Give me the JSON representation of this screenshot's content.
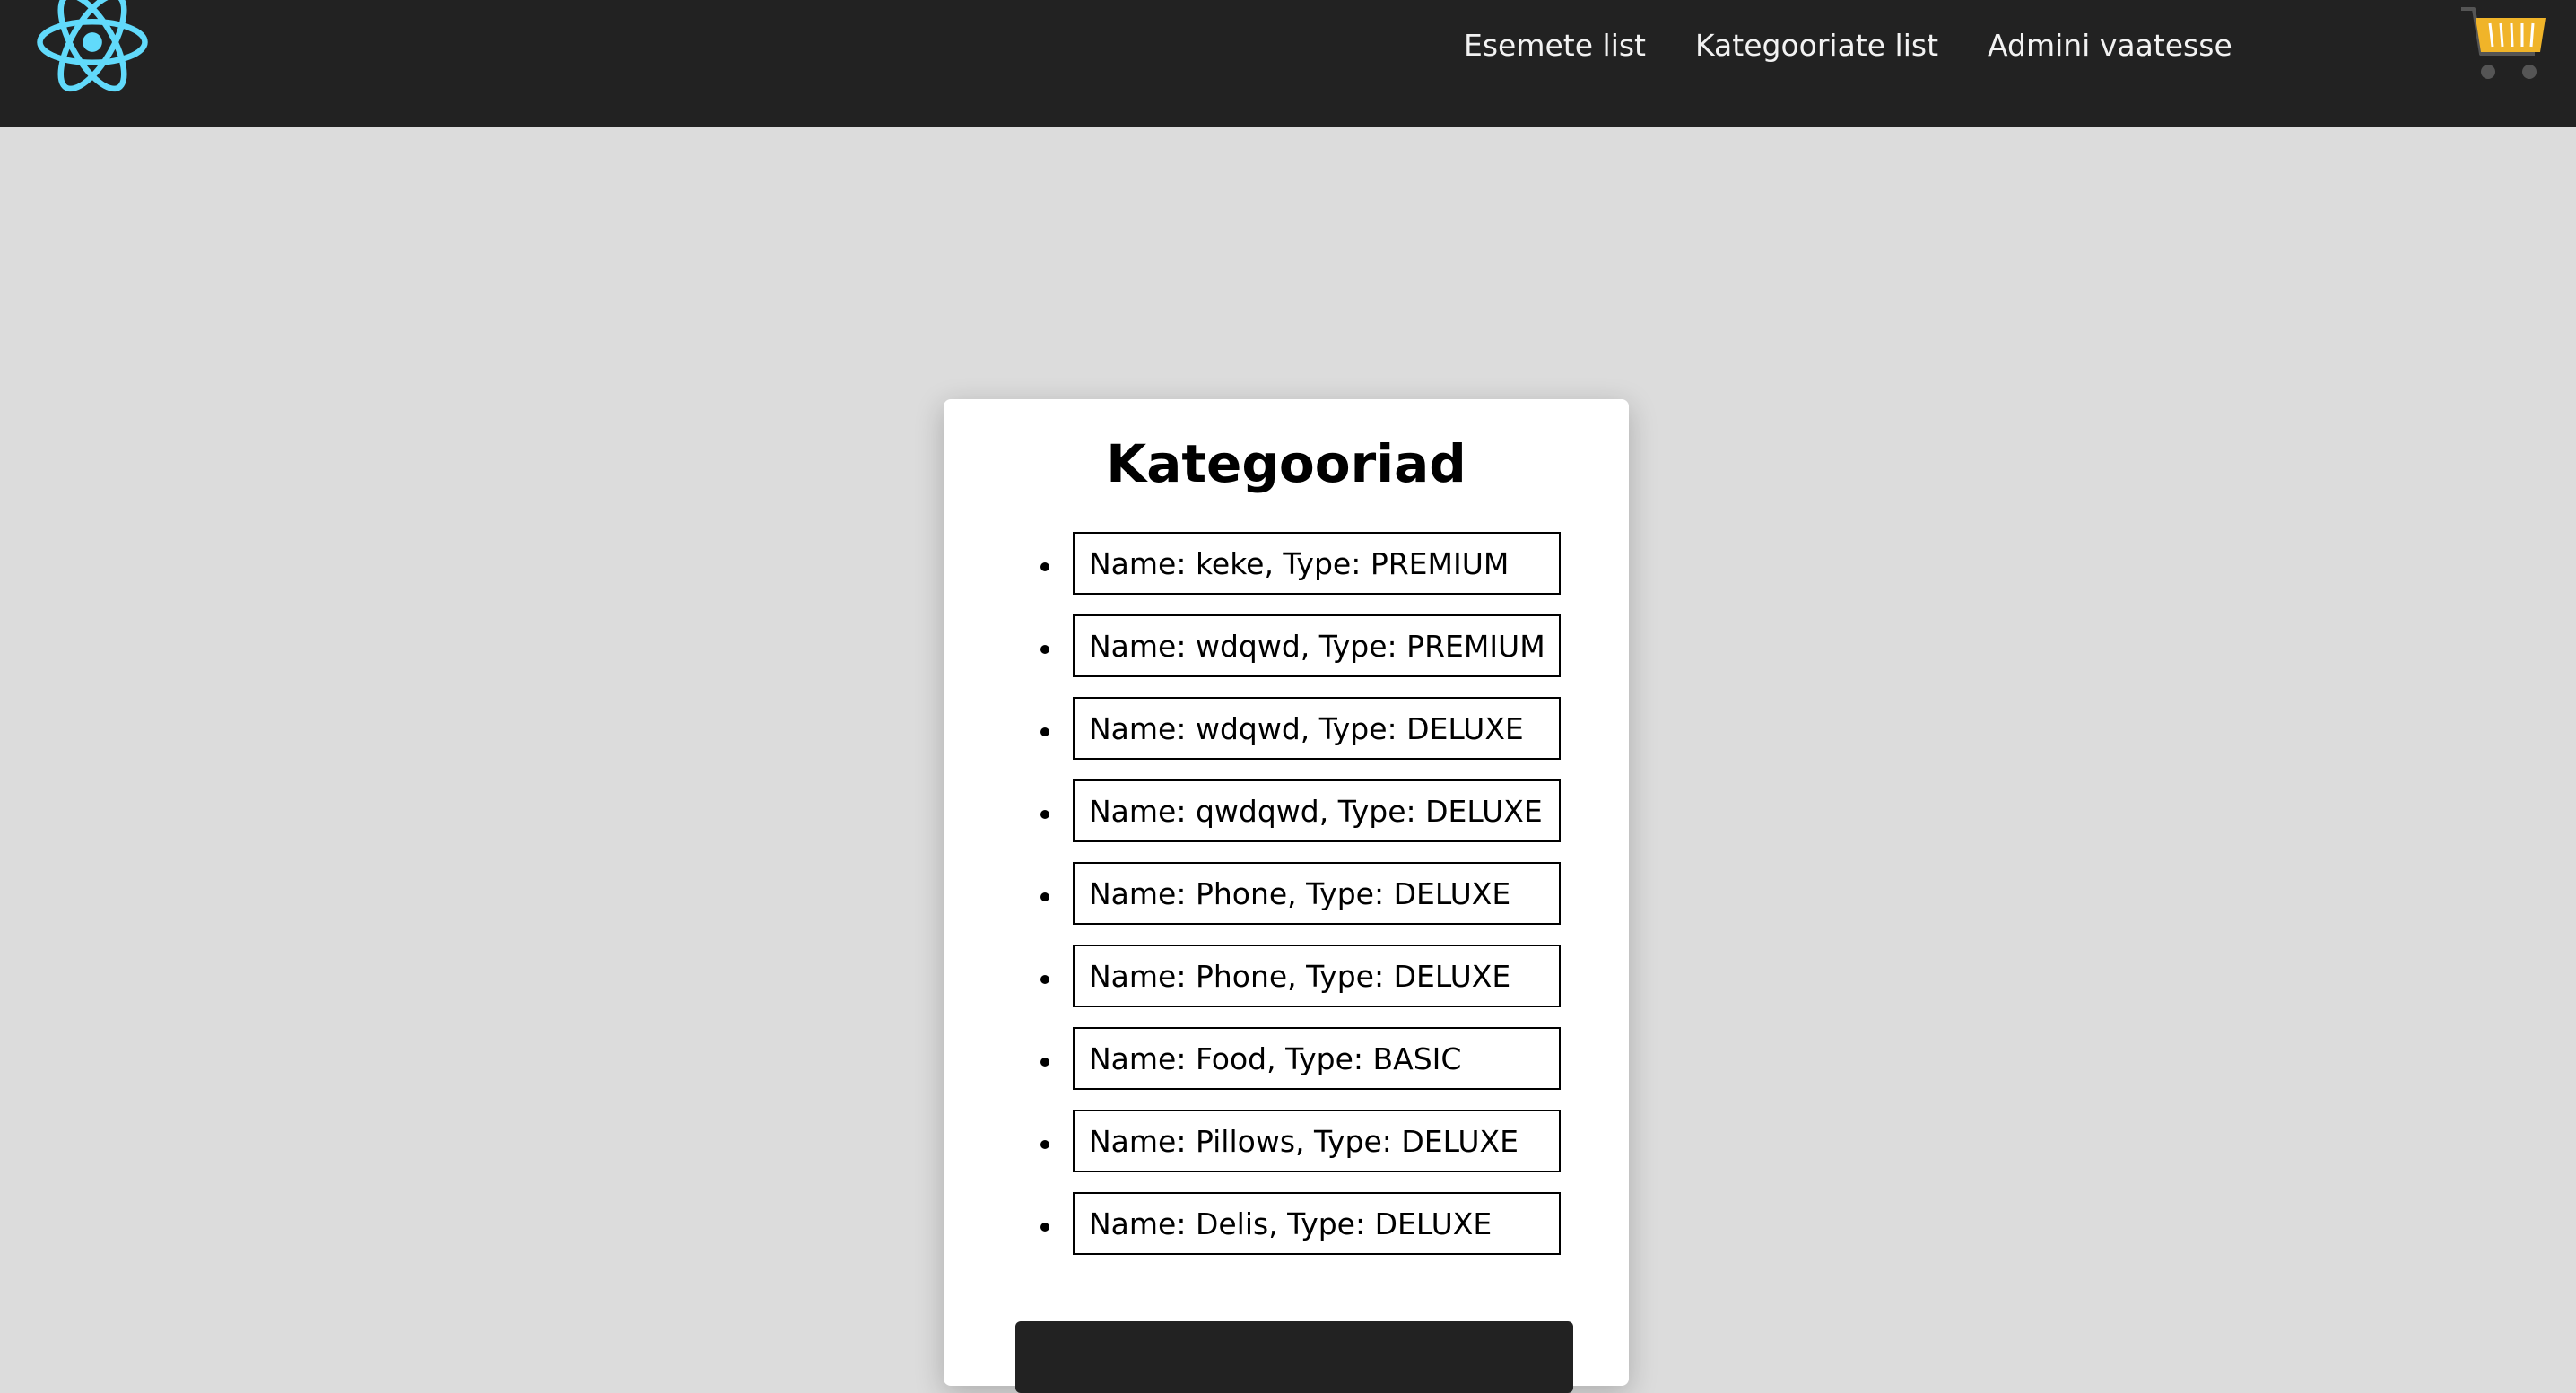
{
  "navbar": {
    "links": [
      {
        "label": "Esemete list"
      },
      {
        "label": "Kategooriate list"
      },
      {
        "label": "Admini vaatesse"
      }
    ],
    "logo_icon": "react-logo-icon",
    "cart_icon": "shopping-cart-icon",
    "background": "#222222",
    "logo_color": "#61dafb",
    "cart_color": "#f0b429"
  },
  "card": {
    "title": "Kategooriad",
    "items": [
      {
        "text": "Name: keke, Type: PREMIUM"
      },
      {
        "text": "Name: wdqwd, Type: PREMIUM"
      },
      {
        "text": "Name: wdqwd, Type: DELUXE"
      },
      {
        "text": "Name: qwdqwd, Type: DELUXE"
      },
      {
        "text": "Name: Phone, Type: DELUXE"
      },
      {
        "text": "Name: Phone, Type: DELUXE"
      },
      {
        "text": "Name: Food, Type: BASIC"
      },
      {
        "text": "Name: Pillows, Type: DELUXE"
      },
      {
        "text": "Name: Delis, Type: DELUXE"
      }
    ]
  }
}
